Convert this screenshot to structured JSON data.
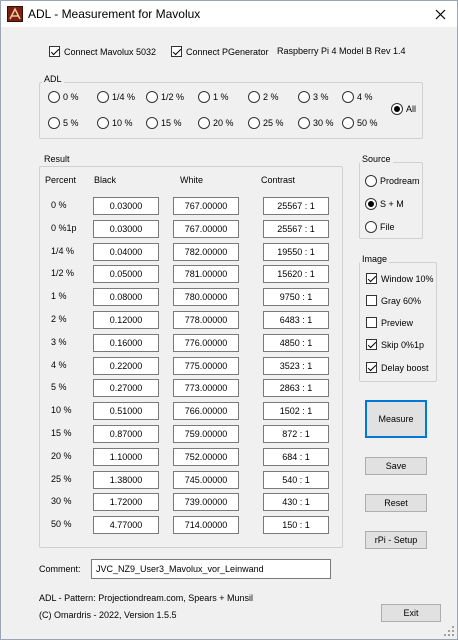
{
  "window": {
    "title": "ADL - Measurement for Mavolux"
  },
  "connections": {
    "mavolux_label": "Connect Mavolux 5032",
    "mavolux_checked": true,
    "pgen_label": "Connect PGenerator",
    "pgen_checked": true,
    "device_info": "Raspberry Pi 4 Model B Rev 1.4"
  },
  "adl": {
    "title": "ADL",
    "options": [
      "0 %",
      "1/4 %",
      "1/2 %",
      "1 %",
      "2 %",
      "3 %",
      "4 %",
      "5 %",
      "10 %",
      "15 %",
      "20 %",
      "25 %",
      "30 %",
      "50 %",
      "All"
    ],
    "selected": "All"
  },
  "result": {
    "title": "Result",
    "headers": {
      "percent": "Percent",
      "black": "Black",
      "white": "White",
      "contrast": "Contrast"
    },
    "rows": [
      {
        "percent": "0 %",
        "black": "0.03000",
        "white": "767.00000",
        "contrast": "25567 : 1"
      },
      {
        "percent": "0 %1p",
        "black": "0.03000",
        "white": "767.00000",
        "contrast": "25567 : 1"
      },
      {
        "percent": "1/4 %",
        "black": "0.04000",
        "white": "782.00000",
        "contrast": "19550 : 1"
      },
      {
        "percent": "1/2 %",
        "black": "0.05000",
        "white": "781.00000",
        "contrast": "15620 : 1"
      },
      {
        "percent": "1 %",
        "black": "0.08000",
        "white": "780.00000",
        "contrast": "9750 : 1"
      },
      {
        "percent": "2 %",
        "black": "0.12000",
        "white": "778.00000",
        "contrast": "6483 : 1"
      },
      {
        "percent": "3 %",
        "black": "0.16000",
        "white": "776.00000",
        "contrast": "4850 : 1"
      },
      {
        "percent": "4 %",
        "black": "0.22000",
        "white": "775.00000",
        "contrast": "3523 : 1"
      },
      {
        "percent": "5 %",
        "black": "0.27000",
        "white": "773.00000",
        "contrast": "2863 : 1"
      },
      {
        "percent": "10 %",
        "black": "0.51000",
        "white": "766.00000",
        "contrast": "1502 : 1"
      },
      {
        "percent": "15 %",
        "black": "0.87000",
        "white": "759.00000",
        "contrast": "872 : 1"
      },
      {
        "percent": "20 %",
        "black": "1.10000",
        "white": "752.00000",
        "contrast": "684 : 1"
      },
      {
        "percent": "25 %",
        "black": "1.38000",
        "white": "745.00000",
        "contrast": "540 : 1"
      },
      {
        "percent": "30 %",
        "black": "1.72000",
        "white": "739.00000",
        "contrast": "430 : 1"
      },
      {
        "percent": "50 %",
        "black": "4.77000",
        "white": "714.00000",
        "contrast": "150 : 1"
      }
    ]
  },
  "source": {
    "title": "Source",
    "options": [
      "Prodream",
      "S + M",
      "File"
    ],
    "selected": "S + M"
  },
  "image": {
    "title": "Image",
    "options": [
      {
        "label": "Window 10%",
        "checked": true
      },
      {
        "label": "Gray 60%",
        "checked": false
      },
      {
        "label": "Preview",
        "checked": false
      },
      {
        "label": "Skip 0%1p",
        "checked": true
      },
      {
        "label": "Delay boost",
        "checked": true
      }
    ]
  },
  "buttons": {
    "measure": "Measure",
    "save": "Save",
    "reset": "Reset",
    "rpi_setup": "rPi - Setup",
    "exit": "Exit"
  },
  "comment": {
    "label": "Comment:",
    "value": "JVC_NZ9_User3_Mavolux_vor_Leinwand"
  },
  "footer": {
    "line1": "ADL - Pattern: Projectiondream.com, Spears + Munsil",
    "line2": "(C) Omardris - 2022, Version 1.5.5"
  }
}
